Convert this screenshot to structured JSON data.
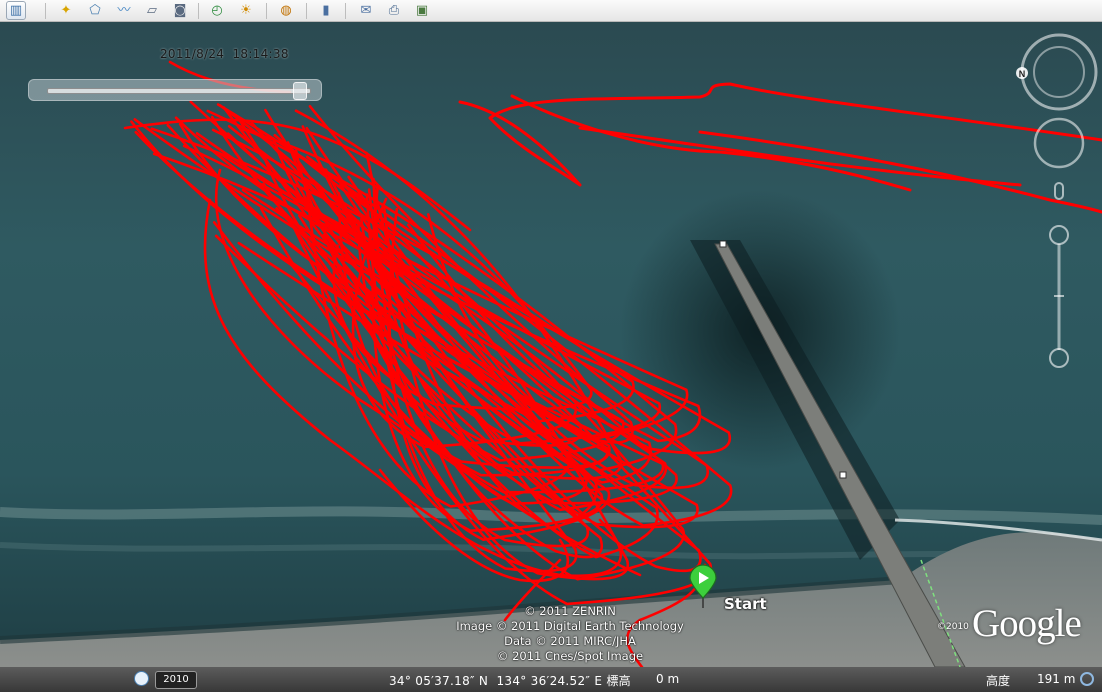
{
  "toolbar": {
    "buttons": [
      {
        "name": "sidebar-toggle-button",
        "icon": "sidebar-icon",
        "glyph": "▥"
      },
      {
        "name": "add-placemark-button",
        "icon": "placemark-star-icon",
        "glyph": "✦"
      },
      {
        "name": "add-polygon-button",
        "icon": "polygon-icon",
        "glyph": "⬠"
      },
      {
        "name": "add-path-button",
        "icon": "path-icon",
        "glyph": "〰"
      },
      {
        "name": "add-image-overlay-button",
        "icon": "image-overlay-icon",
        "glyph": "▱"
      },
      {
        "name": "record-tour-button",
        "icon": "camera-icon",
        "glyph": "◙"
      },
      {
        "name": "historical-imagery-button",
        "icon": "clock-icon",
        "glyph": "◴"
      },
      {
        "name": "sunlight-button",
        "icon": "sun-icon",
        "glyph": "☀"
      },
      {
        "name": "switch-planet-button",
        "icon": "planet-icon",
        "glyph": "◍"
      },
      {
        "name": "ruler-button",
        "icon": "ruler-icon",
        "glyph": "▮"
      },
      {
        "name": "email-button",
        "icon": "email-icon",
        "glyph": "✉"
      },
      {
        "name": "print-button",
        "icon": "print-icon",
        "glyph": "⎙"
      },
      {
        "name": "save-image-button",
        "icon": "picture-icon",
        "glyph": "▣"
      }
    ]
  },
  "time_slider": {
    "date": "2011/8/24",
    "time": "18:14:38",
    "position": 0.96
  },
  "map": {
    "marker_label": "Start",
    "marker_icon": "start-placemark-icon",
    "track_color": "#ff0000",
    "marker_color": "#3ccf3c",
    "copyright_lines": [
      "© 2011 ZENRIN",
      "Image © 2011 Digital Earth Technology",
      "Data © 2011 MIRC/JHA",
      "© 2011 Cnes/Spot Image"
    ],
    "logo": "Google",
    "logo_year": "©2010"
  },
  "navigation": {
    "north_label": "N",
    "look_icon": "look-ring-icon",
    "move_icon": "move-ring-icon",
    "zoom_icon": "zoom-slider-icon"
  },
  "statusbar": {
    "imagery_year": "2010",
    "latitude": "34° 05′37.18″ N",
    "longitude": "134° 36′24.52″ E",
    "elevation_label": "標高",
    "elevation_value": "0 m",
    "eye_alt_label": "高度",
    "eye_alt_value": "191 m"
  }
}
